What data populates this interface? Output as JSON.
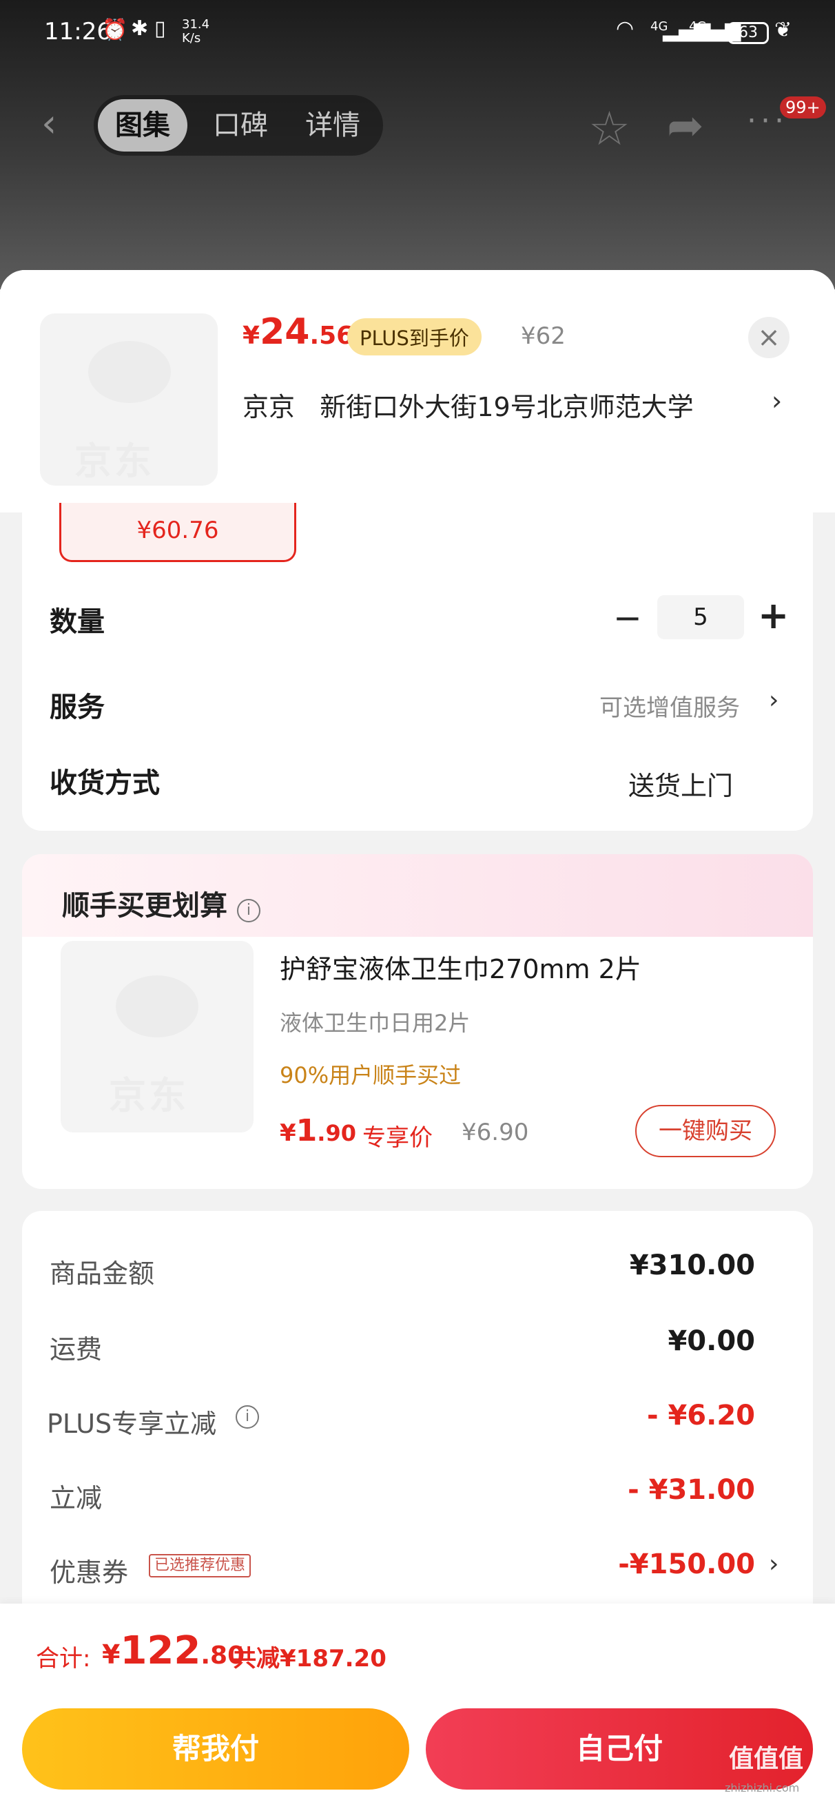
{
  "status_bar": {
    "time": "11:26",
    "net_speed": "31.4 K/s",
    "battery": "63",
    "signal_1": "4G",
    "signal_2": "4G"
  },
  "nav": {
    "tabs": [
      {
        "label": "图集",
        "active": true
      },
      {
        "label": "口碑",
        "active": false
      },
      {
        "label": "详情",
        "active": false
      }
    ],
    "badge": "99+"
  },
  "sheet": {
    "thumb_logo": "京东",
    "price_currency": "¥",
    "price_int": "24",
    "price_dec": ".56",
    "plus_tag": "PLUS到手价",
    "orig_price": "¥62",
    "close_glyph": "×",
    "address_prefix": "京京",
    "address": "新街口外大街19号北京师范大学",
    "address_arrow": "›"
  },
  "options": {
    "spec_price": "¥60.76",
    "quantity_label": "数量",
    "quantity_value": "5",
    "minus_glyph": "−",
    "plus_glyph": "+",
    "service_label": "服务",
    "service_value": "可选增值服务",
    "chevron": "›",
    "delivery_label": "收货方式",
    "delivery_value": "送货上门"
  },
  "addon": {
    "title": "顺手买更划算",
    "info_glyph": "i",
    "thumb_logo": "京东",
    "name": "护舒宝液体卫生巾270mm 2片",
    "subtitle": "液体卫生巾日用2片",
    "users": "90%用户顺手买过",
    "price_currency": "¥",
    "price_int": "1",
    "price_dec": ".90",
    "exclusive": "专享价",
    "orig_price": "¥6.90",
    "buy_button": "一键购买"
  },
  "summary": {
    "rows": [
      {
        "label": "商品金额",
        "value": "¥310.00"
      },
      {
        "label": "运费",
        "value": "¥0.00"
      },
      {
        "label": "PLUS专享立减",
        "value": "- ¥6.20"
      },
      {
        "label": "立减",
        "value": "- ¥31.00"
      },
      {
        "label": "优惠券",
        "value": "-¥150.00"
      }
    ],
    "coupon_tag": "已选推荐优惠",
    "chevron": "›"
  },
  "bottom": {
    "total_label": "合计:",
    "total_currency": "¥",
    "total_int": "122",
    "total_dec": ".80",
    "discount": "共减¥187.20",
    "help_pay": "帮我付",
    "self_pay": "自己付",
    "watermark": "值值值",
    "watermark_sub": "zhizhizhi.com"
  },
  "colors": {
    "accent_red": "#e4251d",
    "plus_gold": "#fbe29a",
    "help_button": "#ffb40f",
    "self_button": "#ec2f3d"
  }
}
